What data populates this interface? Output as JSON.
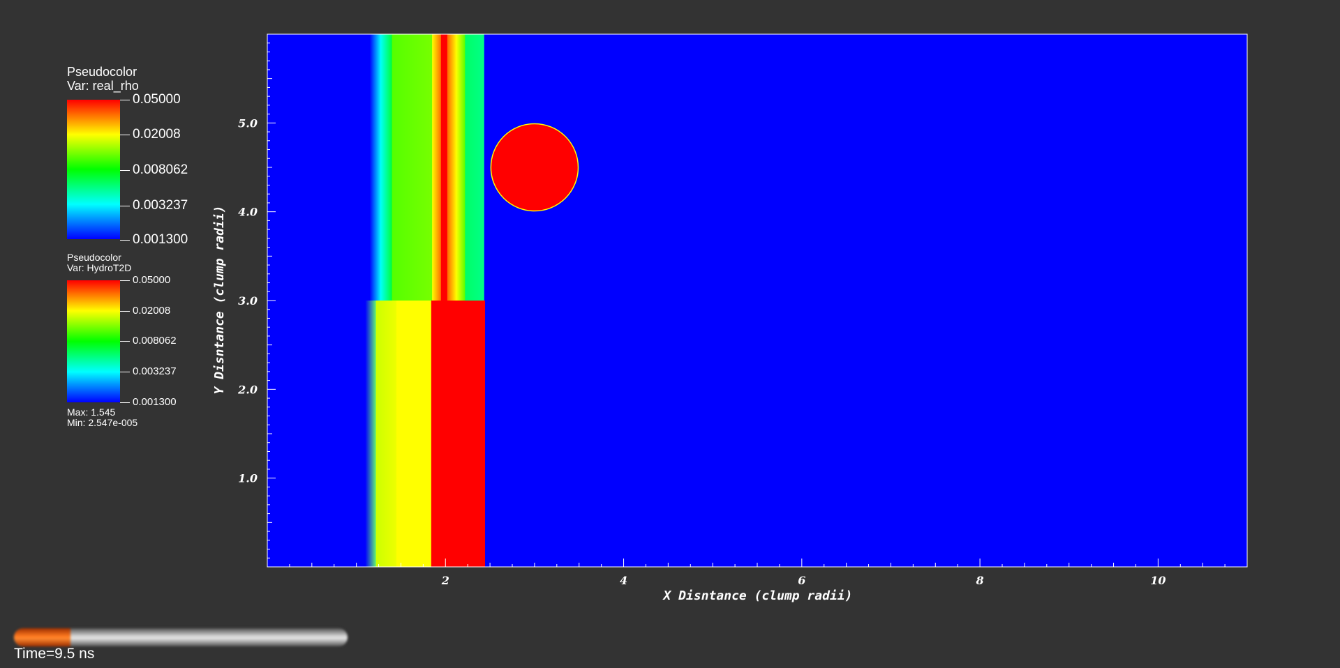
{
  "legend1": {
    "title": "Pseudocolor",
    "var": "Var: real_rho",
    "ticks": [
      "0.05000",
      "0.02008",
      "0.008062",
      "0.003237",
      "0.001300"
    ]
  },
  "legend2": {
    "title": "Pseudocolor",
    "var": "Var: HydroT2D",
    "ticks": [
      "0.05000",
      "0.02008",
      "0.008062",
      "0.003237",
      "0.001300"
    ],
    "max": "Max:  1.545",
    "min": "Min:  2.547e-005"
  },
  "time": {
    "label": "Time=9.5 ns",
    "progress": 0.17
  },
  "colors": {
    "background": "#333333",
    "field": "#0000ff",
    "clump": "#ff0000",
    "clump_edge": "#ffff00",
    "time_fill": "#ff7a20"
  },
  "chart_data": {
    "type": "heatmap",
    "xlabel": "X Disntance (clump radii)",
    "ylabel": "Y Disntance (clump radii)",
    "xlim": [
      0,
      11
    ],
    "ylim": [
      0,
      6
    ],
    "xticks": [
      2,
      4,
      6,
      8,
      10
    ],
    "xtick_labels": [
      "2",
      "4",
      "6",
      "8",
      "10"
    ],
    "yticks": [
      1,
      2,
      3,
      4,
      5
    ],
    "ytick_labels": [
      "1.0",
      "2.0",
      "3.0",
      "4.0",
      "5.0"
    ],
    "colormap": [
      "#0000ff",
      "#00ffff",
      "#00ff00",
      "#ffff00",
      "#ff0000"
    ],
    "upper_region": {
      "y_range": [
        3,
        6
      ],
      "bands": [
        {
          "x0": 1.15,
          "x1": 1.27,
          "color_from": "#0000ff",
          "color_to": "#00ffff"
        },
        {
          "x0": 1.27,
          "x1": 1.4,
          "color_from": "#00ffff",
          "color_to": "#00ff33"
        },
        {
          "x0": 1.4,
          "x1": 1.85,
          "color_from": "#55ff00",
          "color_to": "#77ff00"
        },
        {
          "x0": 1.85,
          "x1": 1.95,
          "color_from": "#ffff00",
          "color_to": "#ff6600"
        },
        {
          "x0": 1.95,
          "x1": 2.02,
          "color_from": "#ff0000",
          "color_to": "#ff0000"
        },
        {
          "x0": 2.02,
          "x1": 2.12,
          "color_from": "#ff6600",
          "color_to": "#ffff00"
        },
        {
          "x0": 2.12,
          "x1": 2.22,
          "color_from": "#ffff00",
          "color_to": "#55ff00"
        },
        {
          "x0": 2.22,
          "x1": 2.43,
          "color_from": "#00ff66",
          "color_to": "#00ff88"
        }
      ]
    },
    "lower_region": {
      "y_range": [
        0,
        3
      ],
      "bands": [
        {
          "x0": 1.1,
          "x1": 1.22,
          "color_from": "#0000ff",
          "color_to": "#66ff66"
        },
        {
          "x0": 1.22,
          "x1": 1.45,
          "color_from": "#ccff00",
          "color_to": "#eeff00"
        },
        {
          "x0": 1.45,
          "x1": 1.84,
          "color_from": "#ffff00",
          "color_to": "#ffff00"
        },
        {
          "x0": 1.84,
          "x1": 2.44,
          "color_from": "#ff0000",
          "color_to": "#ff0000"
        }
      ]
    },
    "clump": {
      "cx": 3.0,
      "cy": 4.5,
      "r": 0.49
    }
  }
}
